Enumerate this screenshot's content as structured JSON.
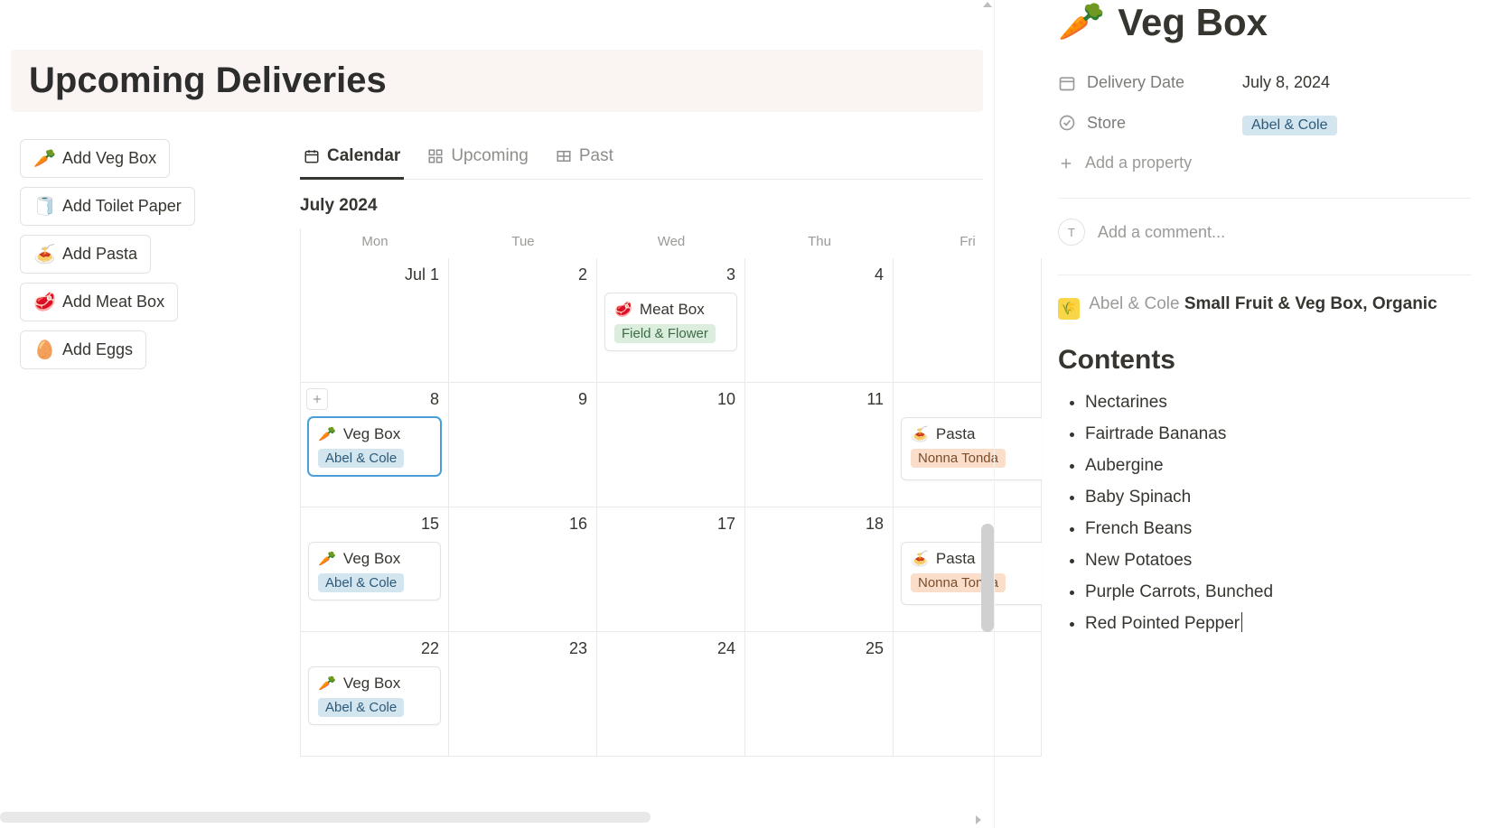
{
  "header": {
    "title": "Upcoming Deliveries"
  },
  "quick_add": [
    {
      "emoji": "🥕",
      "label": "Add Veg Box"
    },
    {
      "emoji": "🧻",
      "label": "Add Toilet Paper"
    },
    {
      "emoji": "🍝",
      "label": "Add Pasta"
    },
    {
      "emoji": "🥩",
      "label": "Add Meat Box"
    },
    {
      "emoji": "🥚",
      "label": "Add Eggs"
    }
  ],
  "tabs": {
    "calendar": "Calendar",
    "upcoming": "Upcoming",
    "past": "Past"
  },
  "calendar": {
    "month_label": "July 2024",
    "day_headers": [
      "Mon",
      "Tue",
      "Wed",
      "Thu",
      "Fri"
    ],
    "weeks": [
      {
        "days": [
          {
            "label": "Jul 1"
          },
          {
            "label": "2"
          },
          {
            "label": "3",
            "event": {
              "emoji": "🥩",
              "title": "Meat Box",
              "tag": "Field & Flower",
              "tag_style": "green"
            }
          },
          {
            "label": "4"
          },
          {
            "label": ""
          }
        ]
      },
      {
        "days": [
          {
            "label": "8",
            "show_add": true,
            "event": {
              "emoji": "🥕",
              "title": "Veg Box",
              "tag": "Abel & Cole",
              "tag_style": "blue",
              "selected": true
            }
          },
          {
            "label": "9"
          },
          {
            "label": "10"
          },
          {
            "label": "11"
          },
          {
            "label": "",
            "event": {
              "emoji": "🍝",
              "title": "Pasta",
              "tag": "Nonna Tonda",
              "tag_style": "orange",
              "overflow": true
            }
          }
        ]
      },
      {
        "days": [
          {
            "label": "15",
            "event": {
              "emoji": "🥕",
              "title": "Veg Box",
              "tag": "Abel & Cole",
              "tag_style": "blue"
            }
          },
          {
            "label": "16"
          },
          {
            "label": "17"
          },
          {
            "label": "18"
          },
          {
            "label": "",
            "event": {
              "emoji": "🍝",
              "title": "Pasta",
              "tag": "Nonna Tonda",
              "tag_style": "orange",
              "overflow": true
            }
          }
        ]
      },
      {
        "days": [
          {
            "label": "22",
            "event": {
              "emoji": "🥕",
              "title": "Veg Box",
              "tag": "Abel & Cole",
              "tag_style": "blue"
            }
          },
          {
            "label": "23"
          },
          {
            "label": "24"
          },
          {
            "label": "25"
          },
          {
            "label": ""
          }
        ]
      }
    ]
  },
  "side": {
    "emoji": "🥕",
    "title": "Veg Box",
    "props": {
      "delivery_date": {
        "label": "Delivery Date",
        "value": "July 8, 2024"
      },
      "store": {
        "label": "Store",
        "value": "Abel & Cole"
      }
    },
    "add_property": "Add a property",
    "comment_avatar": "T",
    "comment_placeholder": "Add a comment...",
    "product_line_grey": "Abel & Cole",
    "product_line_bold": "Small Fruit & Veg Box, Organic",
    "contents_heading": "Contents",
    "contents": [
      "Nectarines",
      "Fairtrade Bananas",
      "Aubergine",
      "Baby Spinach",
      "French Beans",
      "New Potatoes",
      "Purple Carrots, Bunched",
      "Red Pointed Pepper"
    ]
  }
}
